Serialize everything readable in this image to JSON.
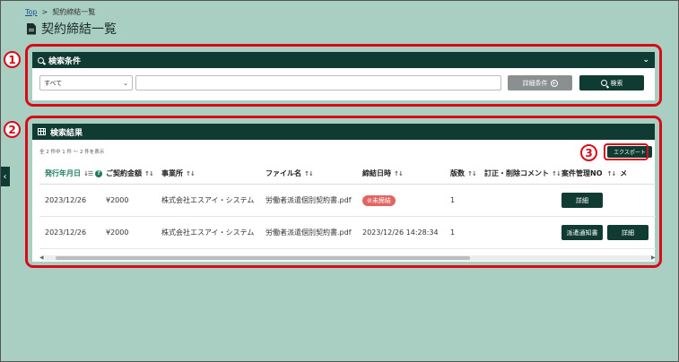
{
  "breadcrumb": {
    "home": "Top",
    "sep": ">",
    "current": "契約締結一覧"
  },
  "page": {
    "title": "契約締結一覧"
  },
  "badges": {
    "one": "1",
    "two": "2",
    "three": "3"
  },
  "search": {
    "header": "検索条件",
    "select_value": "すべて",
    "input_value": "",
    "detail_button": "詳細条件",
    "search_button": "検索"
  },
  "results": {
    "header": "検索結果",
    "count_text": "全 2 件中 1 件 〜 2 件を表示",
    "export_button": "エクスポート",
    "columns": [
      "発行年月日",
      "ご契約金額",
      "事業所",
      "ファイル名",
      "締結日時",
      "版数",
      "訂正・削除コメント",
      "案件管理NO",
      "メ"
    ],
    "rows": [
      {
        "date": "2023/12/26",
        "amount": "¥2000",
        "office": "株式会社エスアイ・システム",
        "file": "労働者派遣個別契約書.pdf",
        "signed": "",
        "status": "⊘未締結",
        "version": "1",
        "comment": "",
        "buttons": [
          "詳細"
        ]
      },
      {
        "date": "2023/12/26",
        "amount": "¥2000",
        "office": "株式会社エスアイ・システム",
        "file": "労働者派遣個別契約書.pdf",
        "signed": "2023/12/26 14:28:34",
        "status": "",
        "version": "1",
        "comment": "",
        "buttons": [
          "派遣通知書",
          "詳細"
        ]
      }
    ]
  },
  "colors": {
    "primary": "#0f3b33",
    "background": "#a9cfc3",
    "annotation": "#d80c18",
    "status_unsigned": "#e06563"
  }
}
